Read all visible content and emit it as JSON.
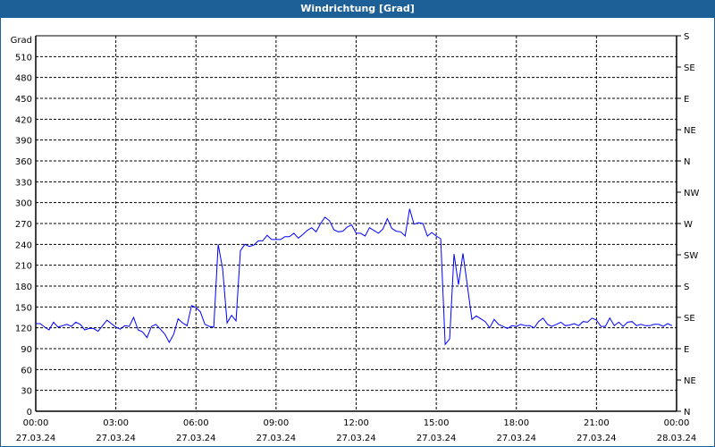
{
  "window": {
    "title": "Windrichtung [Grad]"
  },
  "chart_data": {
    "type": "line",
    "title": "Windrichtung [Grad]",
    "ylabel": "Grad",
    "ylim": [
      0,
      540
    ],
    "yticks": [
      0,
      30,
      60,
      90,
      120,
      150,
      180,
      210,
      240,
      270,
      300,
      330,
      360,
      390,
      420,
      450,
      480,
      510
    ],
    "right_axis": {
      "ticks": [
        0,
        45,
        90,
        135,
        180,
        225,
        270,
        315,
        360,
        405,
        450,
        495,
        540
      ],
      "labels": [
        "N",
        "NE",
        "E",
        "SE",
        "S",
        "SW",
        "W",
        "NW",
        "N",
        "NE",
        "E",
        "SE",
        "S"
      ]
    },
    "xticks": [
      {
        "time": "00:00",
        "date": "27.03.24"
      },
      {
        "time": "03:00",
        "date": "27.03.24"
      },
      {
        "time": "06:00",
        "date": "27.03.24"
      },
      {
        "time": "09:00",
        "date": "27.03.24"
      },
      {
        "time": "12:00",
        "date": "27.03.24"
      },
      {
        "time": "15:00",
        "date": "27.03.24"
      },
      {
        "time": "18:00",
        "date": "27.03.24"
      },
      {
        "time": "21:00",
        "date": "27.03.24"
      },
      {
        "time": "00:00",
        "date": "28.03.24"
      }
    ],
    "xlim_hours": [
      0,
      24
    ],
    "grid": true,
    "series": [
      {
        "name": "Windrichtung",
        "color": "#0000ff",
        "start_hour": 0,
        "step_minutes": 10,
        "values": [
          126,
          126,
          121,
          117,
          128,
          121,
          123,
          125,
          122,
          128,
          125,
          117,
          119,
          119,
          115,
          123,
          131,
          126,
          121,
          118,
          123,
          122,
          135,
          117,
          114,
          106,
          122,
          125,
          118,
          111,
          99,
          111,
          133,
          127,
          123,
          152,
          149,
          143,
          125,
          122,
          121,
          240,
          205,
          127,
          138,
          130,
          231,
          240,
          237,
          239,
          245,
          245,
          253,
          247,
          247,
          247,
          251,
          251,
          256,
          249,
          254,
          260,
          264,
          258,
          270,
          279,
          274,
          261,
          258,
          259,
          265,
          268,
          256,
          256,
          252,
          264,
          260,
          256,
          262,
          277,
          263,
          259,
          258,
          252,
          291,
          269,
          271,
          270,
          252,
          257,
          252,
          248,
          96,
          104,
          226,
          182,
          227,
          180,
          132,
          137,
          133,
          129,
          120,
          132,
          125,
          122,
          119,
          123,
          122,
          125,
          123,
          123,
          120,
          129,
          134,
          125,
          122,
          125,
          128,
          123,
          124,
          126,
          123,
          129,
          128,
          134,
          131,
          122,
          122,
          134,
          123,
          128,
          122,
          128,
          129,
          123,
          125,
          123,
          123,
          125,
          125,
          122,
          126,
          123
        ]
      }
    ]
  }
}
